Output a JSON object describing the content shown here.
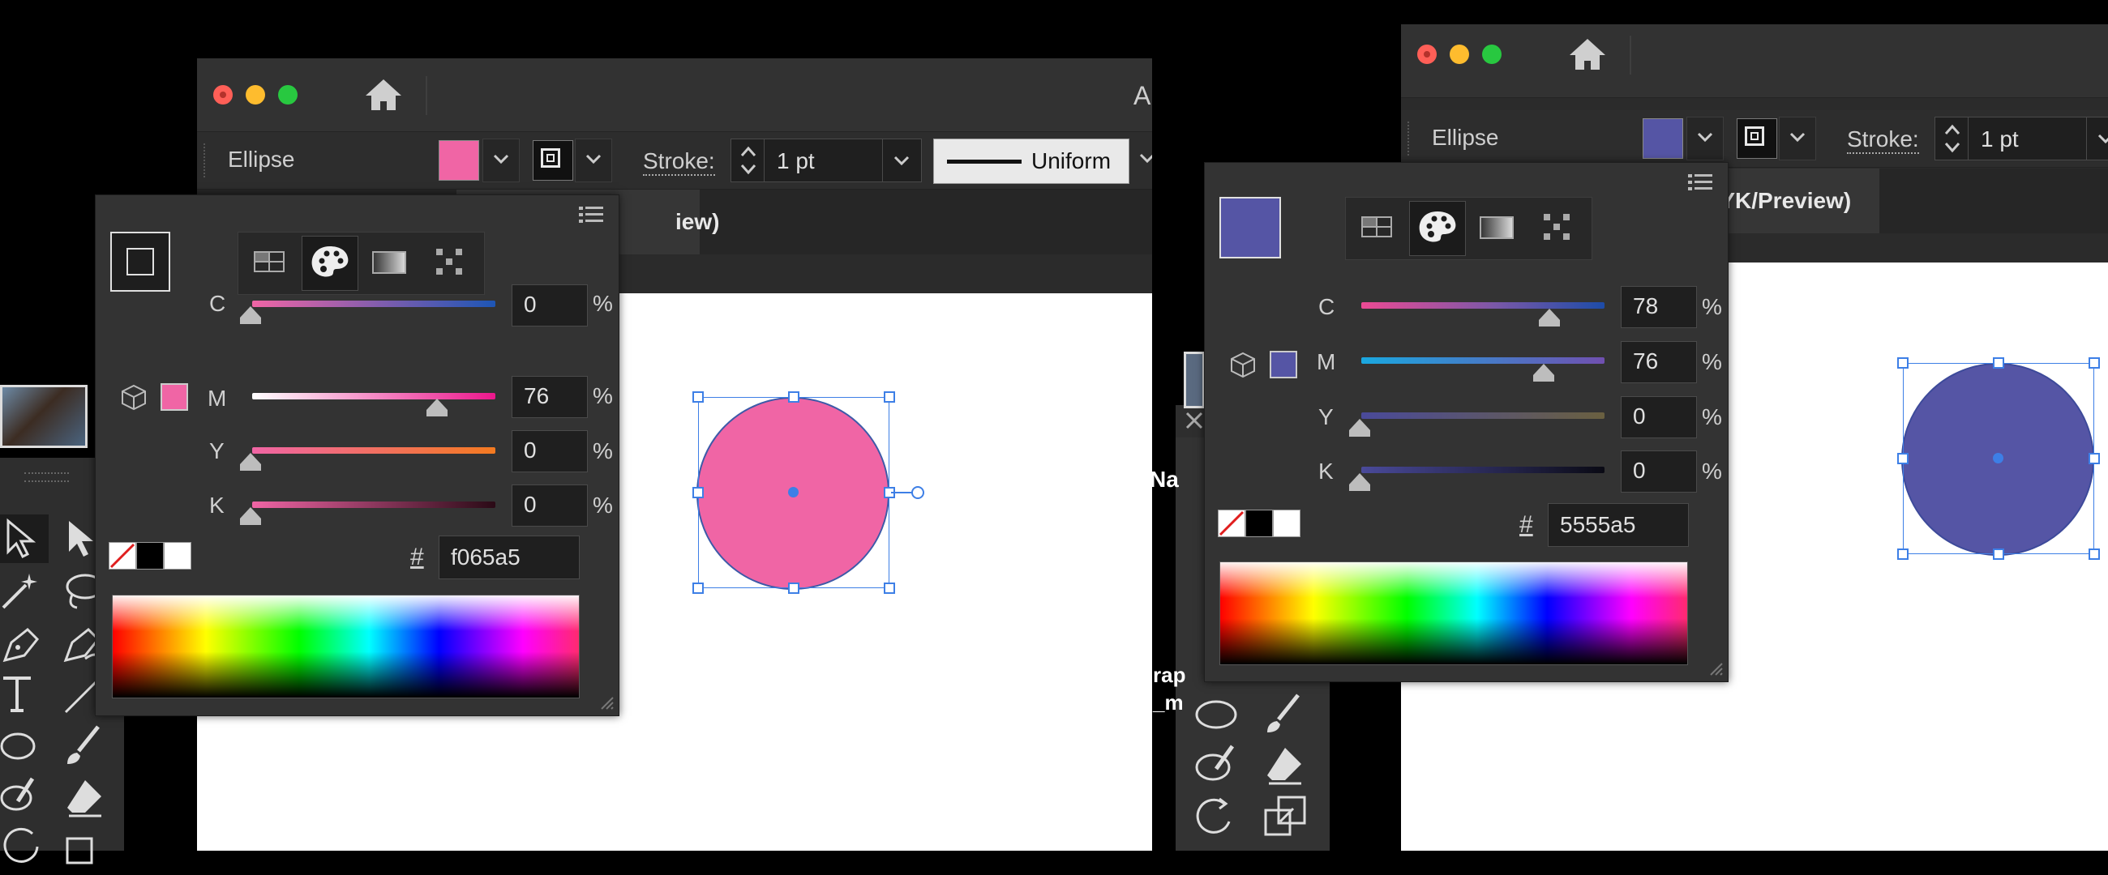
{
  "left": {
    "window_title_partial": "A",
    "object_type": "Ellipse",
    "fill_color": "#f065a5",
    "stroke_label": "Stroke:",
    "stroke_weight": "1 pt",
    "stroke_profile": "Uniform",
    "doc_tab_partial": "iew)",
    "color_panel": {
      "swatch_mode": "stroke",
      "rows": [
        {
          "label": "C",
          "value": "0",
          "unit": "%",
          "fraction": 0.0
        },
        {
          "label": "M",
          "value": "76",
          "unit": "%",
          "fraction": 0.76
        },
        {
          "label": "Y",
          "value": "0",
          "unit": "%",
          "fraction": 0.0
        },
        {
          "label": "K",
          "value": "0",
          "unit": "%",
          "fraction": 0.0
        }
      ],
      "hash_label": "#",
      "hex": "f065a5"
    }
  },
  "right": {
    "object_type": "Ellipse",
    "fill_color": "#5555a5",
    "stroke_label": "Stroke:",
    "stroke_weight": "1 pt",
    "doc_tab_partial": "MYK/Preview)",
    "side_fragments": [
      "Na",
      "rap",
      "_m"
    ],
    "color_panel": {
      "swatch_mode": "fill",
      "rows": [
        {
          "label": "C",
          "value": "78",
          "unit": "%",
          "fraction": 0.78
        },
        {
          "label": "M",
          "value": "76",
          "unit": "%",
          "fraction": 0.76
        },
        {
          "label": "Y",
          "value": "0",
          "unit": "%",
          "fraction": 0.0
        },
        {
          "label": "K",
          "value": "0",
          "unit": "%",
          "fraction": 0.0
        }
      ],
      "hash_label": "#",
      "hex": "5555a5"
    }
  },
  "colors": {
    "pink": "#f065a5",
    "purple": "#5555a5",
    "selection": "#3d7fe6"
  },
  "icons": [
    "home-icon",
    "chevron-down-icon",
    "stepper-icon",
    "panel-menu-icon",
    "color-mode-swatches-icon",
    "color-mode-palette-icon",
    "color-mode-gradient-icon",
    "color-mode-pattern-icon",
    "out-of-gamut-cube-icon",
    "none-swatch-icon",
    "selection-tool-icon",
    "direct-selection-tool-icon",
    "magic-wand-icon",
    "lasso-icon",
    "pen-icon",
    "curvature-icon",
    "type-icon",
    "line-icon",
    "ellipse-tool-icon",
    "paintbrush-icon",
    "blob-brush-icon",
    "eraser-icon",
    "rotate-icon",
    "scale-icon",
    "close-icon"
  ]
}
